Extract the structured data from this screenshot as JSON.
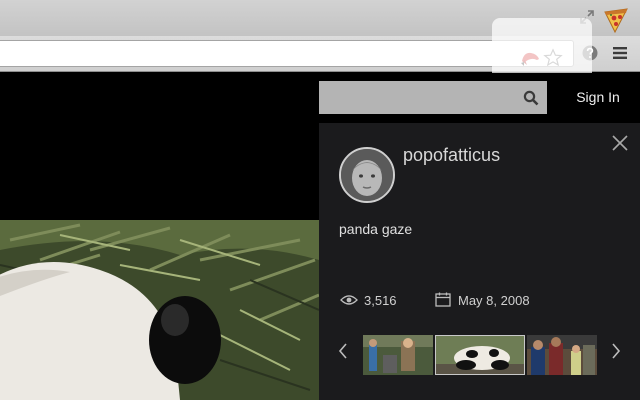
{
  "browser": {
    "toolbar_icons": [
      "fullscreen-icon",
      "pizza-extension-icon",
      "red-extension-icon",
      "star-icon",
      "help-icon",
      "menu-icon"
    ]
  },
  "header": {
    "search_icon": "search-icon",
    "sign_in_label": "Sign In"
  },
  "photo": {
    "owner": "popofatticus",
    "title": "panda gaze",
    "views": "3,516",
    "date": "May 8, 2008"
  },
  "filmstrip": {
    "icons": [
      "chevron-left-icon",
      "chevron-right-icon"
    ],
    "thumbnail_count": 3,
    "selected_index": 1
  },
  "colors": {
    "panel_bg": "#1b1b1d",
    "search_bg": "#b4b4b4",
    "chrome_bg": "#d2d2d2"
  }
}
